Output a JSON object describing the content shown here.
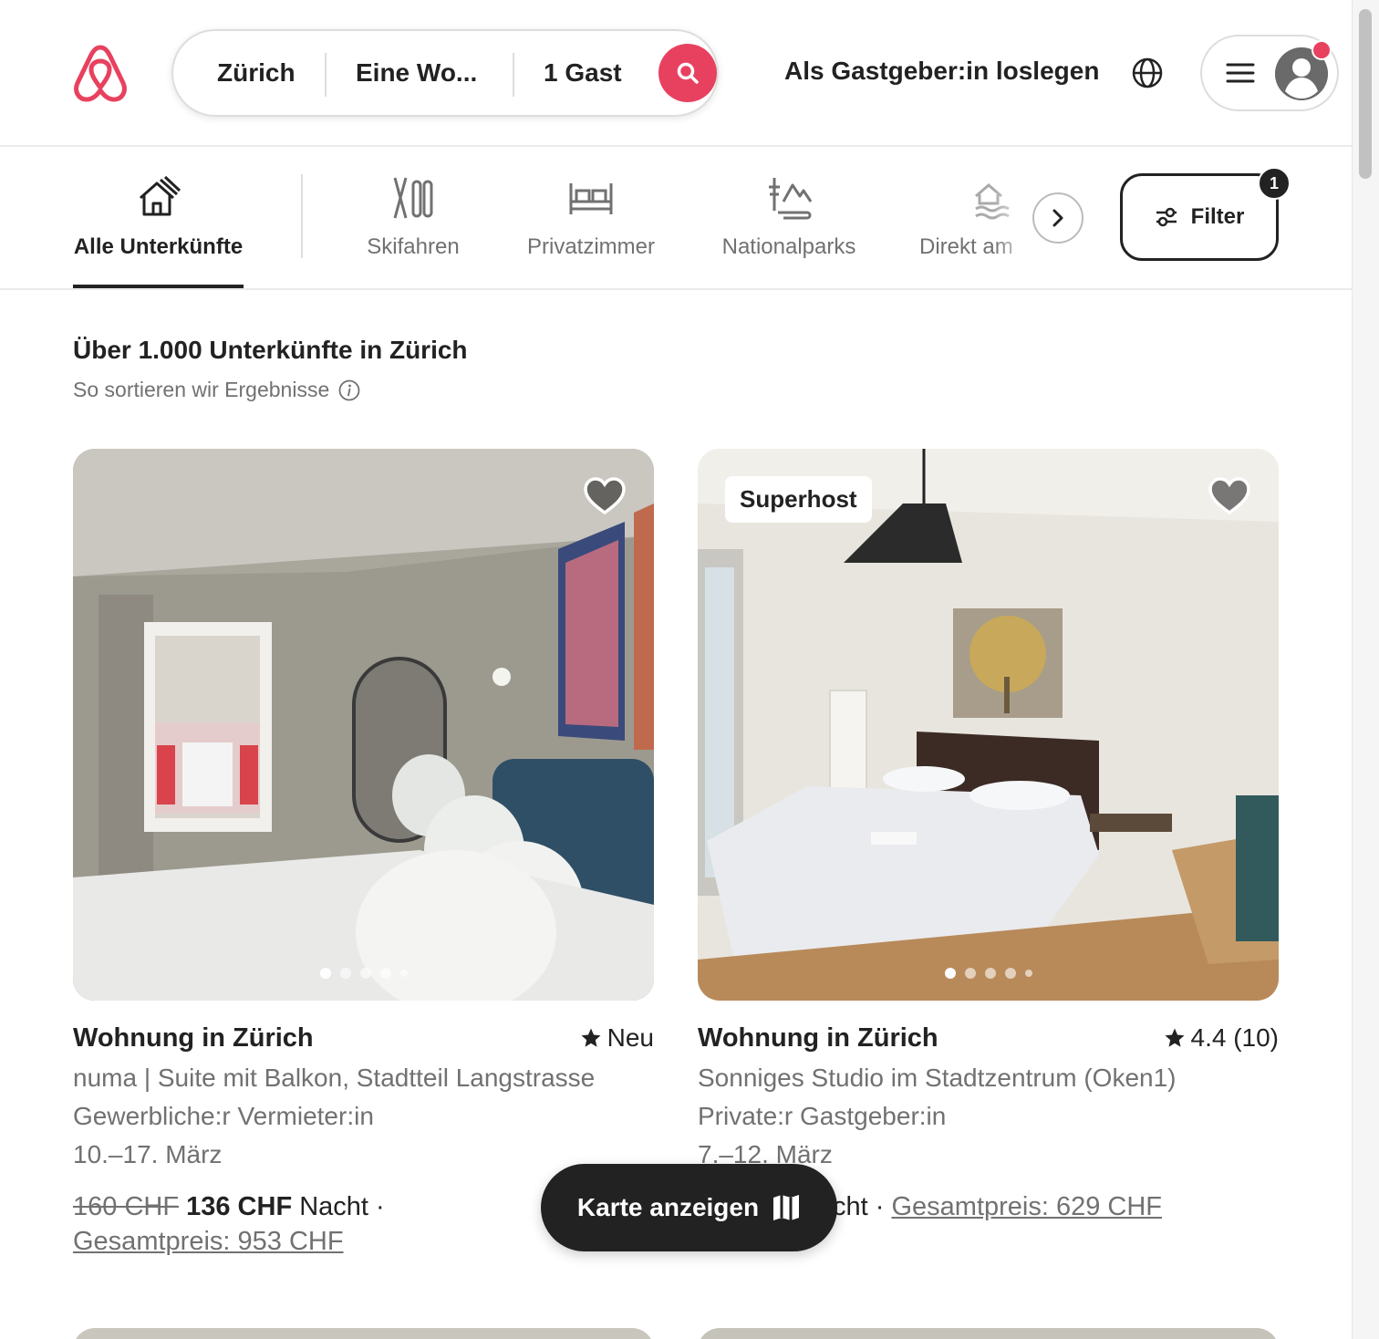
{
  "colors": {
    "brand": "#e8415f",
    "text": "#222222",
    "muted": "#717171"
  },
  "header": {
    "search": {
      "location": "Zürich",
      "dates": "Eine Wo...",
      "guests": "1 Gast"
    },
    "host_link": "Als Gastgeber:in loslegen"
  },
  "categories": {
    "items": [
      {
        "label": "Alle Unterkünfte",
        "icon": "house-icon",
        "active": true
      },
      {
        "label": "Skifahren",
        "icon": "ski-icon"
      },
      {
        "label": "Privatzimmer",
        "icon": "bed-icon"
      },
      {
        "label": "Nationalparks",
        "icon": "park-icon"
      },
      {
        "label": "Direkt am",
        "icon": "waterfront-icon"
      }
    ],
    "filter_label": "Filter",
    "filter_count": "1"
  },
  "results": {
    "title": "Über 1.000 Unterkünfte in Zürich",
    "sort_link": "So sortieren wir Ergebnisse"
  },
  "listings": [
    {
      "title": "Wohnung in Zürich",
      "rating": "Neu",
      "description": "numa | Suite mit Balkon, Stadtteil Langstrasse",
      "host_type": "Gewerbliche:r Vermieter:in",
      "dates": "10.–17. März",
      "old_price": "160 CHF",
      "price": "136 CHF",
      "unit": "Nacht ·",
      "total": "Gesamtpreis: 953 CHF"
    },
    {
      "title": "Wohnung in Zürich",
      "badge": "Superhost",
      "rating": "4.4 (10)",
      "description": "Sonniges Studio im Stadtzentrum (Oken1)",
      "host_type": "Private:r Gastgeber:in",
      "dates": "7.–12. März",
      "unit_tail": "cht ·",
      "total": "Gesamtpreis: 629 CHF"
    }
  ],
  "map_button": "Karte anzeigen"
}
